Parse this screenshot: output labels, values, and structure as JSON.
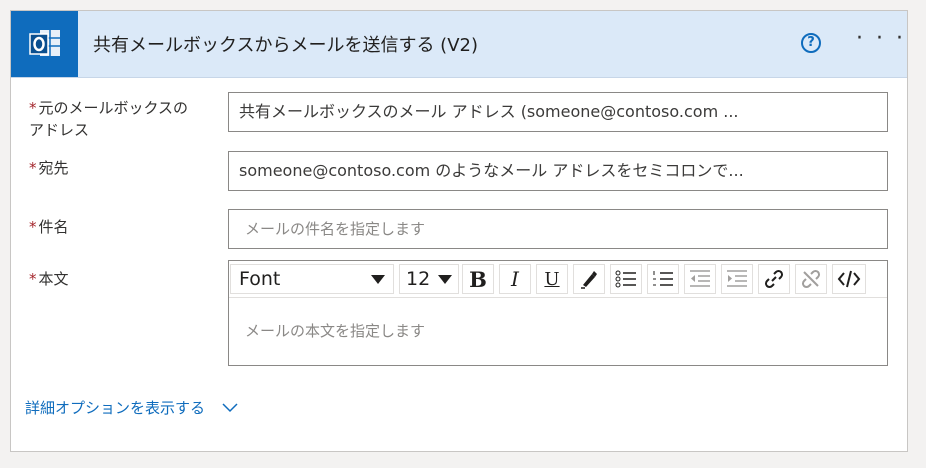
{
  "header": {
    "title": "共有メールボックスからメールを送信する (V2)",
    "app_icon": "outlook-icon",
    "help_icon": "help-circle-icon",
    "more_icon": "more-horizontal-icon",
    "help_glyph": "?",
    "more_glyph": "· · ·"
  },
  "fields": {
    "required_mark": "*",
    "mailbox": {
      "label_line1": "元のメールボックスの",
      "label_line2": "アドレス",
      "value": "共有メールボックスのメール アドレス (someone@contoso.com ..."
    },
    "to": {
      "label": "宛先",
      "value": "someone@contoso.com のようなメール アドレスをセミコロンで..."
    },
    "subject": {
      "label": "件名",
      "placeholder": "メールの件名を指定します"
    },
    "body": {
      "label": "本文",
      "placeholder": "メールの本文を指定します"
    }
  },
  "editor_toolbar": {
    "font": "Font",
    "size": "12",
    "bold": "B",
    "italic": "I",
    "underline": "U",
    "tools": [
      "bold-icon",
      "italic-icon",
      "underline-icon",
      "highlight-pen-icon",
      "bulleted-list-icon",
      "numbered-list-icon",
      "decrease-indent-icon",
      "increase-indent-icon",
      "link-icon",
      "unlink-icon",
      "code-view-icon"
    ]
  },
  "advanced_options": {
    "label": "詳細オプションを表示する",
    "icon": "chevron-down-icon"
  },
  "colors": {
    "accent": "#0f6cbd",
    "header_bg": "#dbe9f8",
    "required": "#a4262c"
  }
}
